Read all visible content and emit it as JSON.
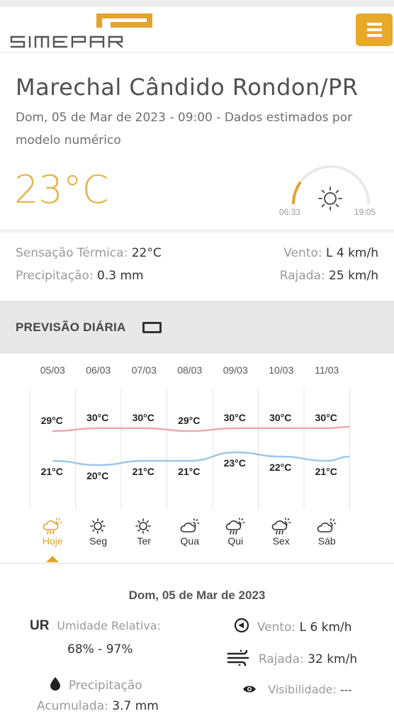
{
  "header": {
    "logo_text": "simepar"
  },
  "location": {
    "city": "Marechal Cândido Rondon/PR",
    "subtitle": "Dom, 05 de Mar de 2023 - 09:00 - Dados estimados por modelo numérico"
  },
  "current": {
    "temperature": "23°C",
    "sunrise": "06:33",
    "sunset": "19:05",
    "sun_progress": 0.2,
    "feels_like_label": "Sensação Térmica:",
    "feels_like_value": "22°C",
    "precip_label": "Precipitação:",
    "precip_value": "0.3 mm",
    "wind_label": "Vento:",
    "wind_value": "L 4 km/h",
    "gust_label": "Rajada:",
    "gust_value": "25 km/h"
  },
  "daily": {
    "title": "PREVISÃO DIÁRIA",
    "icon": "calendar-icon"
  },
  "chart_data": {
    "type": "line",
    "categories": [
      "05/03",
      "06/03",
      "07/03",
      "08/03",
      "09/03",
      "10/03",
      "11/03"
    ],
    "series": [
      {
        "name": "",
        "values": [
          29,
          30,
          30,
          29,
          30,
          30,
          30
        ],
        "labels": [
          "29°C",
          "30°C",
          "30°C",
          "29°C",
          "30°C",
          "30°C",
          "30°C"
        ],
        "color": "#f0a9a9"
      },
      {
        "name": "",
        "values": [
          21,
          20,
          21,
          21,
          23,
          22,
          21
        ],
        "labels": [
          "21°C",
          "20°C",
          "21°C",
          "21°C",
          "23°C",
          "22°C",
          "21°C"
        ],
        "color": "#9cc7ea"
      }
    ],
    "days": [
      {
        "label": "Hoje",
        "icon": "cloud-sun-rain-icon"
      },
      {
        "label": "Seg",
        "icon": "sun-icon"
      },
      {
        "label": "Ter",
        "icon": "sun-icon"
      },
      {
        "label": "Qua",
        "icon": "cloud-sun-icon"
      },
      {
        "label": "Qui",
        "icon": "cloud-sun-rain-icon"
      },
      {
        "label": "Sex",
        "icon": "cloud-sun-rain-icon"
      },
      {
        "label": "Sáb",
        "icon": "cloud-sun-icon"
      }
    ]
  },
  "detail": {
    "date": "Dom, 05 de Mar de 2023",
    "ur_abbr": "UR",
    "humidity_label": "Umidade Relativa:",
    "humidity_value": "68% - 97%",
    "precip_label": "Precipitação",
    "precip_sub_label": "Acumulada:",
    "precip_value": "3.7 mm",
    "wind_label": "Vento:",
    "wind_value": "L 6 km/h",
    "gust_label": "Rajada:",
    "gust_value": "32 km/h",
    "visibility_label": "Visibilidade:",
    "visibility_value": "---"
  },
  "colors": {
    "accent": "#e9a928",
    "temp": "#e3b44a",
    "max_line": "#f0a9a9",
    "min_line": "#9cc7ea"
  }
}
